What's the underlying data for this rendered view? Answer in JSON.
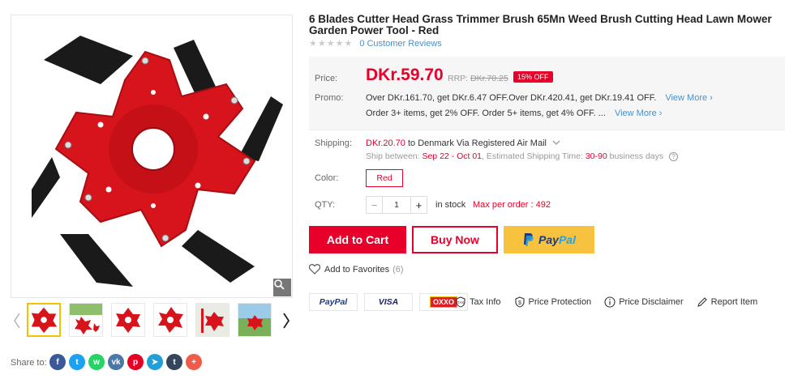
{
  "product": {
    "title": "6 Blades Cutter Head Grass Trimmer Brush 65Mn Weed Brush Cutting Head Lawn Mower Garden Power Tool - Red",
    "reviews_label": "0 Customer Reviews"
  },
  "price": {
    "label": "Price:",
    "current": "DKr.59.70",
    "rrp_label": "RRP:",
    "rrp_value": "DKr.70.25",
    "discount": "15% OFF"
  },
  "promo": {
    "label": "Promo:",
    "line1": "Over DKr.161.70, get DKr.6.47 OFF.Over DKr.420.41, get DKr.19.41 OFF.",
    "line2": "Order 3+ items, get 2% OFF. Order 5+ items, get 4% OFF. ...",
    "view_more": "View More"
  },
  "shipping": {
    "label": "Shipping:",
    "cost": "DKr.20.70",
    "destination": " to Denmark Via Registered Air Mail",
    "between_label": "Ship between: ",
    "between_dates": "Sep 22 - Oct 01",
    "time_label": ", Estimated Shipping Time: ",
    "time_range": "30-90",
    "time_unit": " business days"
  },
  "color": {
    "label": "Color:",
    "selected": "Red"
  },
  "qty": {
    "label": "QTY:",
    "value": "1",
    "stock": "in stock",
    "max": "Max per order : 492"
  },
  "buttons": {
    "add_to_cart": "Add to Cart",
    "buy_now": "Buy Now",
    "paypal_pay": "Pay",
    "paypal_pal": "Pal"
  },
  "favorites": {
    "label": "Add to Favorites",
    "count": "(6)"
  },
  "payment_logos": [
    "PayPal",
    "VISA",
    "OXXO"
  ],
  "links": {
    "tax": "Tax Info",
    "protection": "Price Protection",
    "disclaimer": "Price Disclaimer",
    "report": "Report Item"
  },
  "share": {
    "label": "Share to:"
  },
  "colors": {
    "accent": "#e6002a",
    "link": "#4a90c8",
    "paypal": "#f7c33e"
  }
}
